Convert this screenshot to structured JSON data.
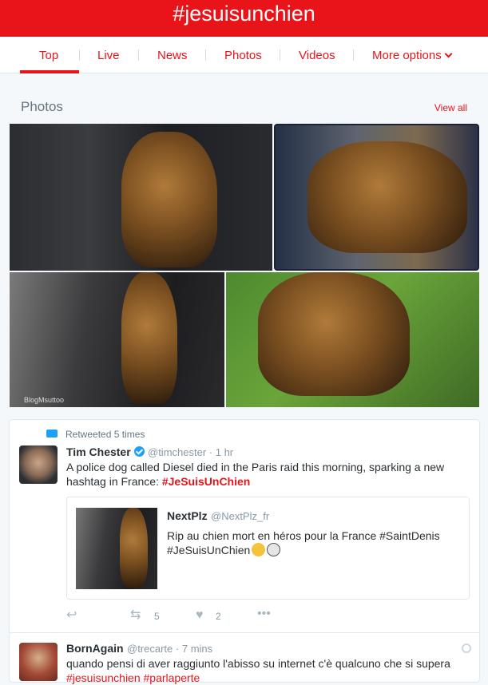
{
  "header": {
    "title": "#jesuisunchien"
  },
  "tabs": [
    {
      "label": "Top"
    },
    {
      "label": "Live"
    },
    {
      "label": "News"
    },
    {
      "label": "Photos"
    },
    {
      "label": "Videos"
    },
    {
      "label": "More options"
    }
  ],
  "photos": {
    "heading": "Photos",
    "view_all": "View all",
    "watermark": "BlogMsuttoo"
  },
  "tweet1": {
    "retweet_text": "Retweeted 5 times",
    "name": "Tim Chester",
    "handle": "@timchester",
    "time": "· 1 hr",
    "text": "A police dog called Diesel died in the Paris raid this morning, sparking a new hashtag in France: ",
    "hashtag": "#JeSuisUnChien",
    "quote": {
      "name": "NextPlz",
      "handle": "@NextPlz_fr",
      "text_line1": "Rip au chien mort en héros pour la France #SaintDenis",
      "text_line2": "#JeSuisUnChien"
    },
    "retweets": "5",
    "likes": "2"
  },
  "tweet2": {
    "name": "BornAgain",
    "handle": "@trecarte",
    "time": "· 7 mins",
    "text": "quando pensi di aver raggiunto l'abisso su internet c'è qualcuno che si supera",
    "hashtag1": "#jesuisunchien",
    "hashtag2": "#parlaperte"
  },
  "colors": {
    "brand": "#e8141a",
    "verified": "#1da1f2"
  },
  "icons": [
    "reply-icon",
    "retweet-icon",
    "like-icon",
    "more-icon",
    "verified-icon",
    "chevron-down-icon",
    "gear-icon"
  ]
}
